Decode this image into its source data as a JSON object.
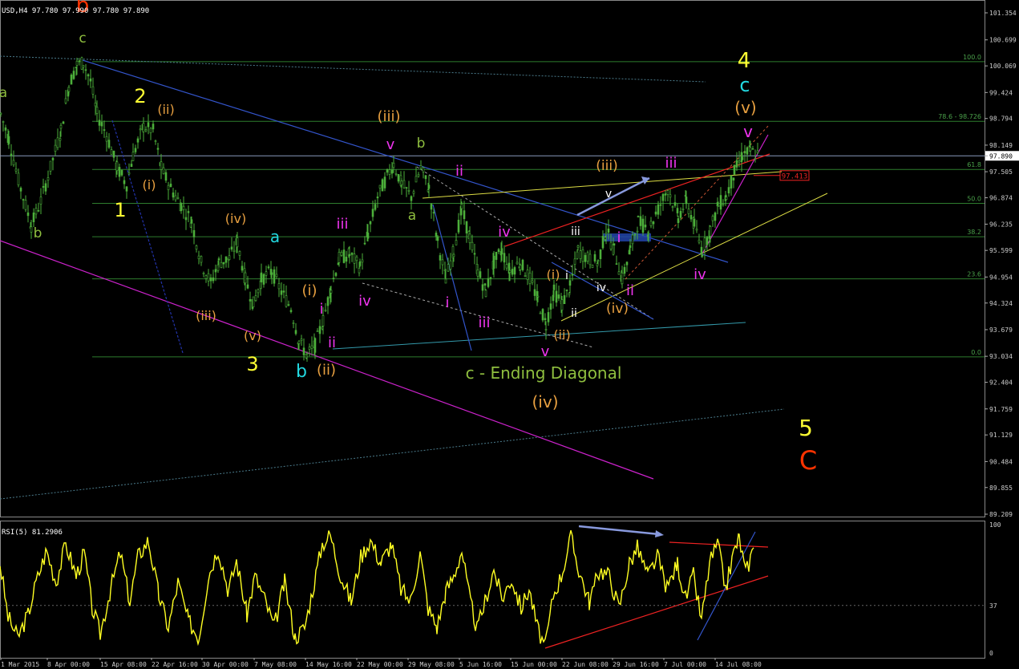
{
  "chart_data": [
    {
      "type": "candlestick",
      "symbol_header": "USD,H4  97.780 97.990 97.780 97.890",
      "price_axis": {
        "min": 89.209,
        "max": 101.354,
        "ticks": [
          "101.354",
          "100.699",
          "100.069",
          "99.424",
          "98.794",
          "98.149",
          "97.890",
          "97.505",
          "96.874",
          "96.235",
          "95.599",
          "94.954",
          "94.324",
          "93.679",
          "93.034",
          "92.404",
          "91.759",
          "91.129",
          "90.484",
          "89.855",
          "89.209"
        ],
        "current_price": "97.890",
        "marked_level": "97.413"
      },
      "time_axis": {
        "ticks": [
          "1 Mar 2015",
          "8 Apr 00:00",
          "15 Apr 08:00",
          "22 Apr 16:00",
          "30 Apr 00:00",
          "7 May 08:00",
          "14 May 16:00",
          "22 May 00:00",
          "29 May 08:00",
          "5 Jun 16:00",
          "15 Jun 00:00",
          "22 Jun 08:00",
          "29 Jun 16:00",
          "7 Jul 00:00",
          "14 Jul 08:00"
        ]
      },
      "fibonacci_levels": [
        {
          "label": "100.0",
          "price": 100.17
        },
        {
          "label": "78.6 - 98.726",
          "price": 98.726
        },
        {
          "label": "61.8",
          "price": 97.56
        },
        {
          "label": "50.0",
          "price": 96.74
        },
        {
          "label": "38.2",
          "price": 95.93
        },
        {
          "label": "23.6",
          "price": 94.91
        },
        {
          "label": "0.0",
          "price": 93.02
        }
      ],
      "price_path": [
        {
          "x": 0,
          "p": 98.9
        },
        {
          "x": 10,
          "p": 98.3
        },
        {
          "x": 22,
          "p": 97.3
        },
        {
          "x": 38,
          "p": 96.2
        },
        {
          "x": 50,
          "p": 96.8
        },
        {
          "x": 62,
          "p": 97.6
        },
        {
          "x": 75,
          "p": 98.5
        },
        {
          "x": 85,
          "p": 99.6
        },
        {
          "x": 95,
          "p": 100.1
        },
        {
          "x": 103,
          "p": 100.15
        },
        {
          "x": 112,
          "p": 99.7
        },
        {
          "x": 120,
          "p": 98.9
        },
        {
          "x": 132,
          "p": 98.4
        },
        {
          "x": 145,
          "p": 97.6
        },
        {
          "x": 157,
          "p": 97.2
        },
        {
          "x": 165,
          "p": 97.9
        },
        {
          "x": 178,
          "p": 98.6
        },
        {
          "x": 190,
          "p": 98.5
        },
        {
          "x": 200,
          "p": 97.6
        },
        {
          "x": 212,
          "p": 97.1
        },
        {
          "x": 225,
          "p": 96.7
        },
        {
          "x": 238,
          "p": 96.3
        },
        {
          "x": 250,
          "p": 95.3
        },
        {
          "x": 262,
          "p": 94.8
        },
        {
          "x": 272,
          "p": 95.3
        },
        {
          "x": 285,
          "p": 95.4
        },
        {
          "x": 295,
          "p": 95.8
        },
        {
          "x": 305,
          "p": 94.9
        },
        {
          "x": 315,
          "p": 94.3
        },
        {
          "x": 325,
          "p": 94.9
        },
        {
          "x": 338,
          "p": 95.1
        },
        {
          "x": 350,
          "p": 94.6
        },
        {
          "x": 362,
          "p": 94.2
        },
        {
          "x": 372,
          "p": 93.4
        },
        {
          "x": 382,
          "p": 93.05
        },
        {
          "x": 392,
          "p": 93.3
        },
        {
          "x": 402,
          "p": 93.9
        },
        {
          "x": 412,
          "p": 94.7
        },
        {
          "x": 422,
          "p": 95.4
        },
        {
          "x": 435,
          "p": 95.5
        },
        {
          "x": 448,
          "p": 95.2
        },
        {
          "x": 458,
          "p": 96.0
        },
        {
          "x": 470,
          "p": 96.9
        },
        {
          "x": 482,
          "p": 97.4
        },
        {
          "x": 490,
          "p": 97.7
        },
        {
          "x": 500,
          "p": 97.2
        },
        {
          "x": 512,
          "p": 96.9
        },
        {
          "x": 524,
          "p": 97.6
        },
        {
          "x": 534,
          "p": 97.1
        },
        {
          "x": 545,
          "p": 95.8
        },
        {
          "x": 555,
          "p": 94.9
        },
        {
          "x": 565,
          "p": 95.6
        },
        {
          "x": 575,
          "p": 96.6
        },
        {
          "x": 585,
          "p": 95.9
        },
        {
          "x": 595,
          "p": 95.1
        },
        {
          "x": 605,
          "p": 94.6
        },
        {
          "x": 615,
          "p": 95.3
        },
        {
          "x": 625,
          "p": 95.6
        },
        {
          "x": 635,
          "p": 95.1
        },
        {
          "x": 648,
          "p": 95.3
        },
        {
          "x": 660,
          "p": 94.9
        },
        {
          "x": 670,
          "p": 94.4
        },
        {
          "x": 680,
          "p": 93.8
        },
        {
          "x": 690,
          "p": 94.6
        },
        {
          "x": 700,
          "p": 94.3
        },
        {
          "x": 710,
          "p": 94.7
        },
        {
          "x": 720,
          "p": 95.6
        },
        {
          "x": 732,
          "p": 95.4
        },
        {
          "x": 745,
          "p": 95.3
        },
        {
          "x": 755,
          "p": 96.1
        },
        {
          "x": 765,
          "p": 95.6
        },
        {
          "x": 775,
          "p": 94.9
        },
        {
          "x": 785,
          "p": 95.6
        },
        {
          "x": 795,
          "p": 96.3
        },
        {
          "x": 808,
          "p": 96.1
        },
        {
          "x": 820,
          "p": 96.6
        },
        {
          "x": 832,
          "p": 97.1
        },
        {
          "x": 845,
          "p": 96.4
        },
        {
          "x": 855,
          "p": 96.8
        },
        {
          "x": 865,
          "p": 96.2
        },
        {
          "x": 875,
          "p": 95.6
        },
        {
          "x": 885,
          "p": 96.1
        },
        {
          "x": 895,
          "p": 96.7
        },
        {
          "x": 905,
          "p": 96.9
        },
        {
          "x": 915,
          "p": 97.5
        },
        {
          "x": 925,
          "p": 97.9
        },
        {
          "x": 935,
          "p": 98.0
        },
        {
          "x": 945,
          "p": 97.9
        }
      ],
      "wave_labels": [
        {
          "text": "b",
          "x": 103,
          "y": 15,
          "color": "#ff3300",
          "size": 26
        },
        {
          "text": "c",
          "x": 103,
          "y": 53,
          "color": "#8fbf3f",
          "size": 17
        },
        {
          "text": "a",
          "x": 4,
          "y": 121,
          "color": "#8fbf3f",
          "size": 17
        },
        {
          "text": "b",
          "x": 47,
          "y": 296,
          "color": "#8fbf3f",
          "size": 17
        },
        {
          "text": "2",
          "x": 175,
          "y": 128,
          "color": "#ffff33",
          "size": 24
        },
        {
          "text": "(ii)",
          "x": 207,
          "y": 142,
          "color": "#e8a040",
          "size": 16
        },
        {
          "text": "(i)",
          "x": 186,
          "y": 236,
          "color": "#e8a040",
          "size": 16
        },
        {
          "text": "1",
          "x": 150,
          "y": 270,
          "color": "#ffff33",
          "size": 24
        },
        {
          "text": "(iv)",
          "x": 294,
          "y": 278,
          "color": "#e8a040",
          "size": 16
        },
        {
          "text": "a",
          "x": 343,
          "y": 302,
          "color": "#22d8e0",
          "size": 20
        },
        {
          "text": "iii",
          "x": 427,
          "y": 285,
          "color": "#ee33ee",
          "size": 18
        },
        {
          "text": "(iii)",
          "x": 257,
          "y": 399,
          "color": "#e8a040",
          "size": 16
        },
        {
          "text": "(v)",
          "x": 315,
          "y": 424,
          "color": "#e8a040",
          "size": 16
        },
        {
          "text": "3",
          "x": 315,
          "y": 462,
          "color": "#ffff33",
          "size": 24
        },
        {
          "text": "(i)",
          "x": 386,
          "y": 368,
          "color": "#e8a040",
          "size": 18
        },
        {
          "text": "i",
          "x": 401,
          "y": 391,
          "color": "#ee33ee",
          "size": 18
        },
        {
          "text": "ii",
          "x": 414,
          "y": 433,
          "color": "#ee33ee",
          "size": 18
        },
        {
          "text": "b",
          "x": 376,
          "y": 470,
          "color": "#22d8e0",
          "size": 22
        },
        {
          "text": "(ii)",
          "x": 407,
          "y": 467,
          "color": "#e8a040",
          "size": 18
        },
        {
          "text": "iv",
          "x": 455,
          "y": 381,
          "color": "#ee33ee",
          "size": 18
        },
        {
          "text": "(iii)",
          "x": 485,
          "y": 151,
          "color": "#e8a040",
          "size": 18
        },
        {
          "text": "v",
          "x": 487,
          "y": 186,
          "color": "#ee33ee",
          "size": 18
        },
        {
          "text": "b",
          "x": 525,
          "y": 184,
          "color": "#8fbf3f",
          "size": 17
        },
        {
          "text": "a",
          "x": 514,
          "y": 274,
          "color": "#8fbf3f",
          "size": 17
        },
        {
          "text": "ii",
          "x": 573,
          "y": 219,
          "color": "#ee33ee",
          "size": 18
        },
        {
          "text": "iv",
          "x": 629,
          "y": 295,
          "color": "#ee33ee",
          "size": 18
        },
        {
          "text": "i",
          "x": 558,
          "y": 383,
          "color": "#ee33ee",
          "size": 18
        },
        {
          "text": "iii",
          "x": 604,
          "y": 408,
          "color": "#ee33ee",
          "size": 18
        },
        {
          "text": "v",
          "x": 680,
          "y": 444,
          "color": "#ee33ee",
          "size": 18
        },
        {
          "text": "(ii)",
          "x": 701,
          "y": 423,
          "color": "#e8a040",
          "size": 16
        },
        {
          "text": "(i)",
          "x": 690,
          "y": 348,
          "color": "#e8a040",
          "size": 16
        },
        {
          "text": "i",
          "x": 707,
          "y": 348,
          "color": "#ffffff",
          "size": 14
        },
        {
          "text": "ii",
          "x": 716,
          "y": 395,
          "color": "#ffffff",
          "size": 14
        },
        {
          "text": "iii",
          "x": 718,
          "y": 293,
          "color": "#ffffff",
          "size": 14
        },
        {
          "text": "iv",
          "x": 750,
          "y": 363,
          "color": "#ffffff",
          "size": 14
        },
        {
          "text": "v",
          "x": 759,
          "y": 246,
          "color": "#ffffff",
          "size": 14
        },
        {
          "text": "(iii)",
          "x": 757,
          "y": 212,
          "color": "#e8a040",
          "size": 17
        },
        {
          "text": "(iv)",
          "x": 770,
          "y": 390,
          "color": "#e8a040",
          "size": 17
        },
        {
          "text": "i",
          "x": 772,
          "y": 302,
          "color": "#ee33ee",
          "size": 18
        },
        {
          "text": "ii",
          "x": 786,
          "y": 368,
          "color": "#ee33ee",
          "size": 18
        },
        {
          "text": "iii",
          "x": 837,
          "y": 209,
          "color": "#ee33ee",
          "size": 18
        },
        {
          "text": "iv",
          "x": 873,
          "y": 348,
          "color": "#ee33ee",
          "size": 18
        },
        {
          "text": "v",
          "x": 933,
          "y": 171,
          "color": "#ee33ee",
          "size": 20
        },
        {
          "text": "(v)",
          "x": 930,
          "y": 141,
          "color": "#e8a040",
          "size": 20
        },
        {
          "text": "c",
          "x": 929,
          "y": 114,
          "color": "#22d8e0",
          "size": 24
        },
        {
          "text": "4",
          "x": 928,
          "y": 84,
          "color": "#ffff33",
          "size": 26
        },
        {
          "text": "(iv)",
          "x": 680,
          "y": 508,
          "color": "#e8a040",
          "size": 20
        },
        {
          "text": "c - Ending Diagonal",
          "x": 678,
          "y": 472,
          "color": "#8fbf3f",
          "size": 20
        },
        {
          "text": "5",
          "x": 1005,
          "y": 543,
          "color": "#ffff33",
          "size": 28
        },
        {
          "text": "C",
          "x": 1008,
          "y": 585,
          "color": "#ff3300",
          "size": 32
        }
      ]
    },
    {
      "type": "line",
      "indicator_label": "RSI(5) 81.2906",
      "ylim": [
        0,
        100
      ],
      "ticks": [
        "100",
        "37",
        "0"
      ],
      "level": 37,
      "series": [
        {
          "x": 0,
          "v": 70
        },
        {
          "x": 10,
          "v": 28
        },
        {
          "x": 22,
          "v": 12
        },
        {
          "x": 35,
          "v": 30
        },
        {
          "x": 45,
          "v": 55
        },
        {
          "x": 58,
          "v": 80
        },
        {
          "x": 70,
          "v": 55
        },
        {
          "x": 82,
          "v": 85
        },
        {
          "x": 95,
          "v": 60
        },
        {
          "x": 105,
          "v": 78
        },
        {
          "x": 115,
          "v": 35
        },
        {
          "x": 125,
          "v": 15
        },
        {
          "x": 138,
          "v": 50
        },
        {
          "x": 150,
          "v": 78
        },
        {
          "x": 162,
          "v": 40
        },
        {
          "x": 172,
          "v": 75
        },
        {
          "x": 185,
          "v": 88
        },
        {
          "x": 198,
          "v": 45
        },
        {
          "x": 210,
          "v": 20
        },
        {
          "x": 222,
          "v": 55
        },
        {
          "x": 235,
          "v": 25
        },
        {
          "x": 248,
          "v": 12
        },
        {
          "x": 260,
          "v": 60
        },
        {
          "x": 272,
          "v": 82
        },
        {
          "x": 285,
          "v": 48
        },
        {
          "x": 295,
          "v": 72
        },
        {
          "x": 308,
          "v": 30
        },
        {
          "x": 318,
          "v": 60
        },
        {
          "x": 330,
          "v": 42
        },
        {
          "x": 342,
          "v": 20
        },
        {
          "x": 355,
          "v": 55
        },
        {
          "x": 368,
          "v": 12
        },
        {
          "x": 380,
          "v": 20
        },
        {
          "x": 392,
          "v": 55
        },
        {
          "x": 402,
          "v": 85
        },
        {
          "x": 412,
          "v": 92
        },
        {
          "x": 425,
          "v": 60
        },
        {
          "x": 438,
          "v": 40
        },
        {
          "x": 450,
          "v": 75
        },
        {
          "x": 462,
          "v": 88
        },
        {
          "x": 475,
          "v": 70
        },
        {
          "x": 488,
          "v": 85
        },
        {
          "x": 500,
          "v": 50
        },
        {
          "x": 512,
          "v": 40
        },
        {
          "x": 524,
          "v": 78
        },
        {
          "x": 534,
          "v": 35
        },
        {
          "x": 545,
          "v": 20
        },
        {
          "x": 556,
          "v": 48
        },
        {
          "x": 566,
          "v": 60
        },
        {
          "x": 576,
          "v": 80
        },
        {
          "x": 585,
          "v": 45
        },
        {
          "x": 595,
          "v": 18
        },
        {
          "x": 606,
          "v": 42
        },
        {
          "x": 616,
          "v": 65
        },
        {
          "x": 626,
          "v": 42
        },
        {
          "x": 638,
          "v": 58
        },
        {
          "x": 650,
          "v": 35
        },
        {
          "x": 660,
          "v": 50
        },
        {
          "x": 670,
          "v": 20
        },
        {
          "x": 680,
          "v": 4
        },
        {
          "x": 690,
          "v": 45
        },
        {
          "x": 700,
          "v": 60
        },
        {
          "x": 712,
          "v": 90
        },
        {
          "x": 722,
          "v": 65
        },
        {
          "x": 735,
          "v": 40
        },
        {
          "x": 748,
          "v": 65
        },
        {
          "x": 760,
          "v": 60
        },
        {
          "x": 772,
          "v": 35
        },
        {
          "x": 785,
          "v": 70
        },
        {
          "x": 795,
          "v": 82
        },
        {
          "x": 808,
          "v": 60
        },
        {
          "x": 820,
          "v": 75
        },
        {
          "x": 832,
          "v": 50
        },
        {
          "x": 845,
          "v": 70
        },
        {
          "x": 855,
          "v": 42
        },
        {
          "x": 865,
          "v": 60
        },
        {
          "x": 875,
          "v": 25
        },
        {
          "x": 885,
          "v": 70
        },
        {
          "x": 895,
          "v": 85
        },
        {
          "x": 905,
          "v": 50
        },
        {
          "x": 915,
          "v": 78
        },
        {
          "x": 922,
          "v": 90
        },
        {
          "x": 930,
          "v": 62
        },
        {
          "x": 940,
          "v": 82
        }
      ]
    }
  ]
}
